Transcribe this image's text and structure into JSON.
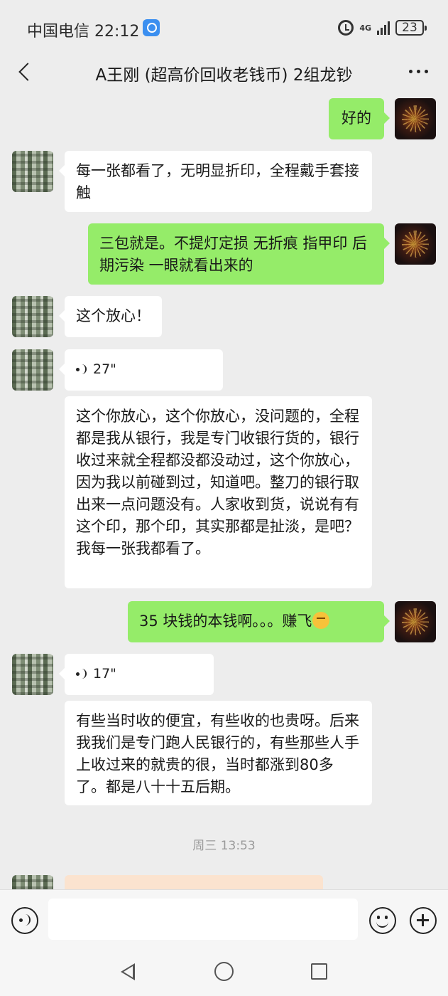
{
  "status_bar": {
    "carrier_time": "中国电信 22:12",
    "network": "4G",
    "battery": "23"
  },
  "header": {
    "title": "A王刚 (超高价回收老钱币) 2组龙钞"
  },
  "messages": [
    {
      "from": "me",
      "type": "text",
      "text": "好的"
    },
    {
      "from": "other",
      "type": "text",
      "text": "每一张都看了，无明显折印，全程戴手套接触"
    },
    {
      "from": "me",
      "type": "text",
      "text": "三包就是。不提灯定损  无折痕 指甲印 后期污染    一眼就看出来的"
    },
    {
      "from": "other",
      "type": "text",
      "text": "这个放心！"
    },
    {
      "from": "other",
      "type": "voice",
      "duration": "27\""
    },
    {
      "from": "other",
      "type": "transcript",
      "text": "这个你放心，这个你放心，没问题的，全程都是我从银行，我是专门收银行货的，银行收过来就全程都没都没动过，这个你放心，因为我以前碰到过，知道吧。整刀的银行取出来一点问题没有。人家收到货，说说有有这个印，那个印，其实那都是扯淡，是吧？我每一张我都看了。"
    },
    {
      "from": "me",
      "type": "text",
      "text": "35 块钱的本钱啊。。。赚飞"
    },
    {
      "from": "other",
      "type": "voice",
      "duration": "17\""
    },
    {
      "from": "other",
      "type": "transcript",
      "text": "有些当时收的便宜，有些收的也贵呀。后来我我们是专门跑人民银行的，有些那些人手上收过来的就贵的很，当时都涨到80多了。都是八十十五后期。"
    }
  ],
  "timestamp": "周三 13:53",
  "input": {
    "value": ""
  }
}
